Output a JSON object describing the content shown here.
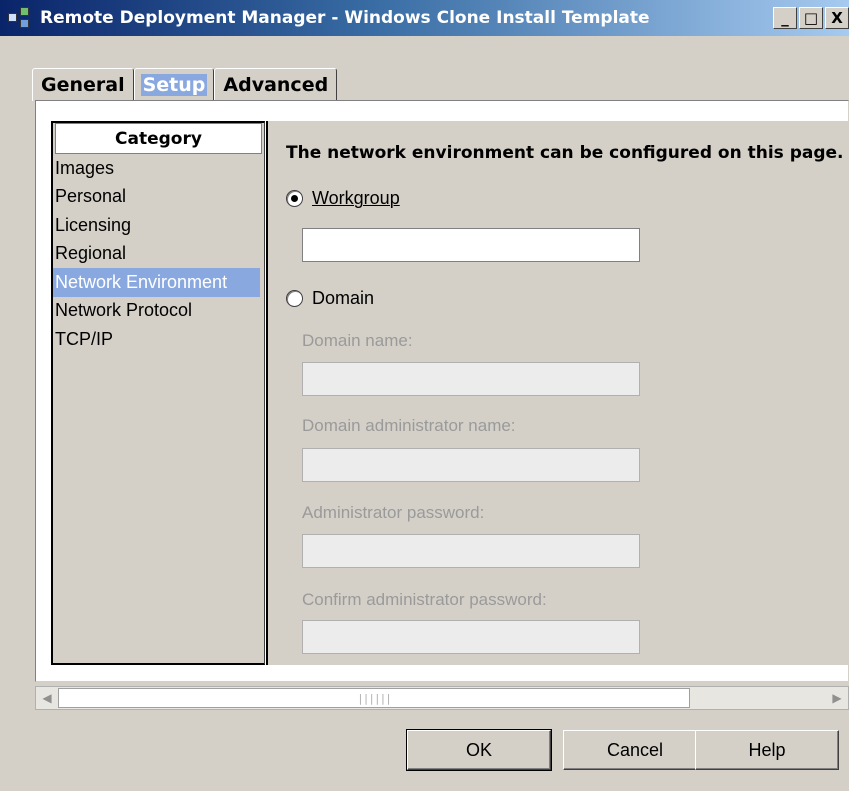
{
  "window": {
    "title": "Remote Deployment Manager - Windows Clone Install Template",
    "controls": [
      "_",
      "□",
      "X"
    ]
  },
  "tabs": [
    {
      "label": "General",
      "active": false
    },
    {
      "label": "Setup",
      "active": true
    },
    {
      "label": "Advanced",
      "active": false
    }
  ],
  "category": {
    "header": "Category",
    "items": [
      "Images",
      "Personal",
      "Licensing",
      "Regional",
      "Network Environment",
      "Network Protocol",
      "TCP/IP"
    ],
    "selected": "Network Environment"
  },
  "content": {
    "description": "The network environment can be configured on this page.",
    "workgroup": {
      "label": "Workgroup",
      "selected": true,
      "value": ""
    },
    "domain": {
      "label": "Domain",
      "selected": false
    },
    "domain_name": {
      "label": "Domain name:",
      "value": ""
    },
    "domain_admin_name": {
      "label": "Domain administrator name:",
      "value": ""
    },
    "admin_password": {
      "label": "Administrator password:",
      "value": ""
    },
    "confirm_password": {
      "label": "Confirm administrator password:",
      "value": ""
    }
  },
  "buttons": {
    "ok": "OK",
    "cancel": "Cancel",
    "help": "Help"
  },
  "scrollbar": {
    "thumb_grip": "||||||"
  }
}
